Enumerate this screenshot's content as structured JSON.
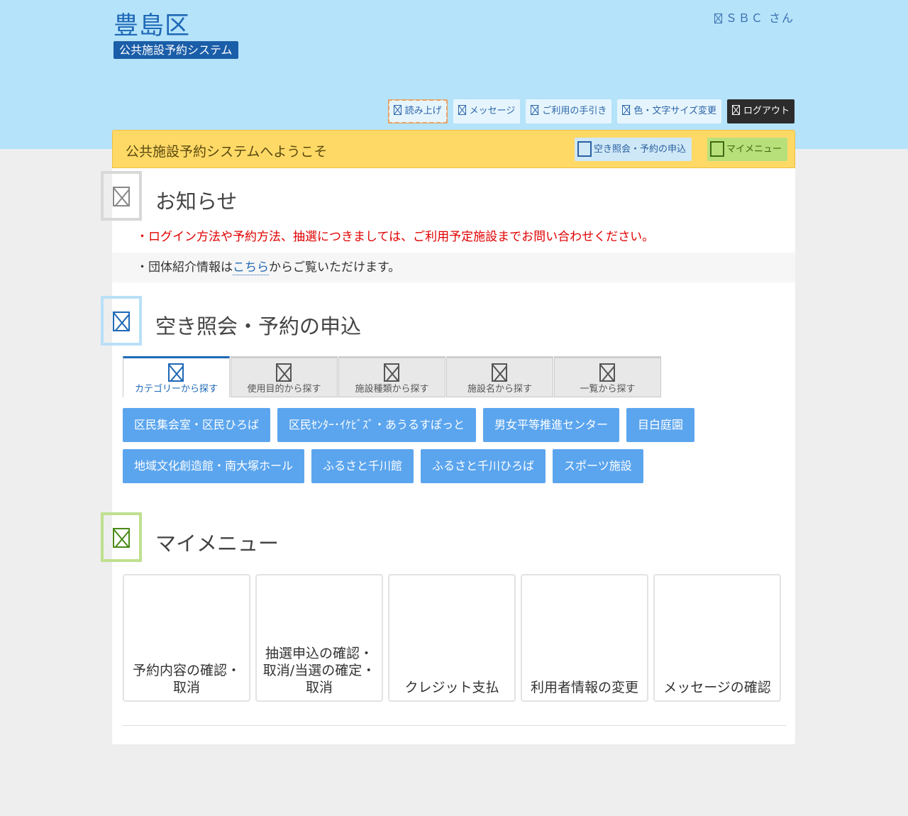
{
  "header": {
    "title": "豊島区",
    "subtitle": "公共施設予約システム",
    "user_name": "ＳＢＣ さん",
    "toolbar": [
      {
        "label": "読み上げ",
        "icon": "speaker-icon"
      },
      {
        "label": "メッセージ",
        "icon": "message-icon"
      },
      {
        "label": "ご利用の手引き",
        "icon": "guide-icon"
      },
      {
        "label": "色・文字サイズ変更",
        "icon": "palette-icon"
      },
      {
        "label": "ログアウト",
        "icon": "logout-icon"
      }
    ]
  },
  "welcome": {
    "title": "公共施設予約システムへようこそ",
    "availability_button": "空き照会・予約の申込",
    "mymenu_button": "マイメニュー"
  },
  "notice": {
    "heading": "お知らせ",
    "item1": "・ログイン方法や予約方法、抽選につきましては、ご利用予定施設までお問い合わせください。",
    "item2_prefix": "・団体紹介情報は",
    "item2_link": "こちら",
    "item2_suffix": "からご覧いただけます。"
  },
  "search": {
    "heading": "空き照会・予約の申込",
    "tabs": [
      {
        "label": "カテゴリーから探す",
        "active": true
      },
      {
        "label": "使用目的から探す",
        "active": false
      },
      {
        "label": "施設種類から探す",
        "active": false
      },
      {
        "label": "施設名から探す",
        "active": false
      },
      {
        "label": "一覧から探す",
        "active": false
      }
    ],
    "categories_row1": [
      "区民集会室・区民ひろば",
      "区民ｾﾝﾀｰ･ｲｹﾋﾞｽﾞ・あうるすぽっと",
      "男女平等推進センター",
      "目白庭園"
    ],
    "categories_row2": [
      "地域文化創造館・南大塚ホール",
      "ふるさと千川館",
      "ふるさと千川ひろば",
      "スポーツ施設"
    ]
  },
  "mymenu": {
    "heading": "マイメニュー",
    "cards": [
      "予約内容の確認・取消",
      "抽選申込の確認・取消/当選の確定・取消",
      "クレジット支払",
      "利用者情報の変更",
      "メッセージの確認"
    ]
  },
  "colors": {
    "header_bg": "#b5e3fa",
    "brand_blue": "#1e68b6",
    "welcome_bar": "#ffd966",
    "category_button": "#5ba5ee",
    "mymenu_green": "#b8e07a",
    "notice_red": "#e00000"
  }
}
